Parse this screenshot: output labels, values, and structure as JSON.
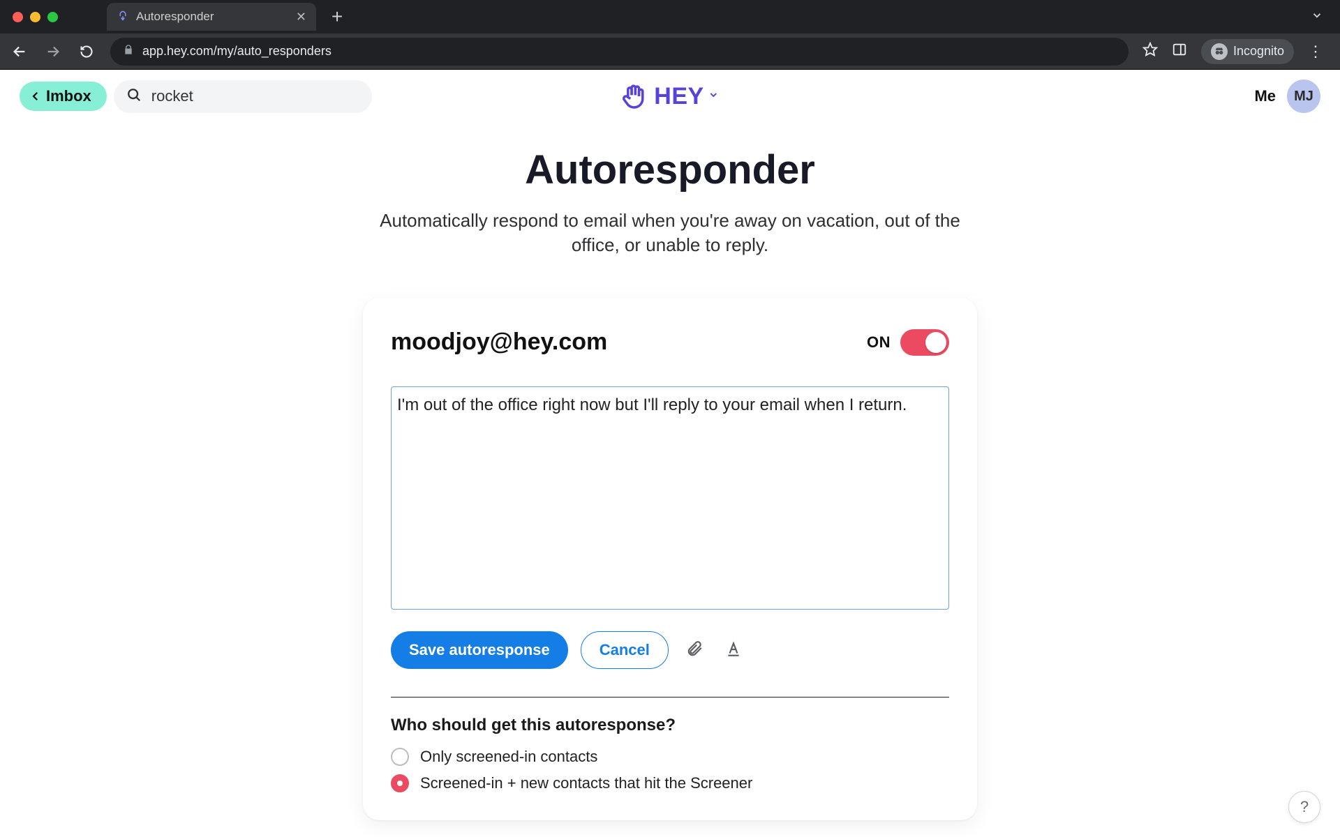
{
  "browser": {
    "tab_title": "Autoresponder",
    "url": "app.hey.com/my/auto_responders",
    "incognito_label": "Incognito"
  },
  "header": {
    "imbox_label": "Imbox",
    "search_value": "rocket",
    "logo_text": "HEY",
    "me_label": "Me",
    "avatar_initials": "MJ"
  },
  "page": {
    "title": "Autoresponder",
    "subtitle": "Automatically respond to email when you're away on vacation, out of the office, or unable to reply."
  },
  "card": {
    "email": "moodjoy@hey.com",
    "toggle_label": "ON",
    "toggle_on": true,
    "message": "I'm out of the office right now but I'll reply to your email when I return.",
    "save_label": "Save autoresponse",
    "cancel_label": "Cancel",
    "recipients_heading": "Who should get this autoresponse?",
    "recipients_options": [
      {
        "label": "Only screened-in contacts",
        "checked": false
      },
      {
        "label": "Screened-in + new contacts that hit the Screener",
        "checked": true
      }
    ]
  },
  "help": {
    "label": "?"
  }
}
